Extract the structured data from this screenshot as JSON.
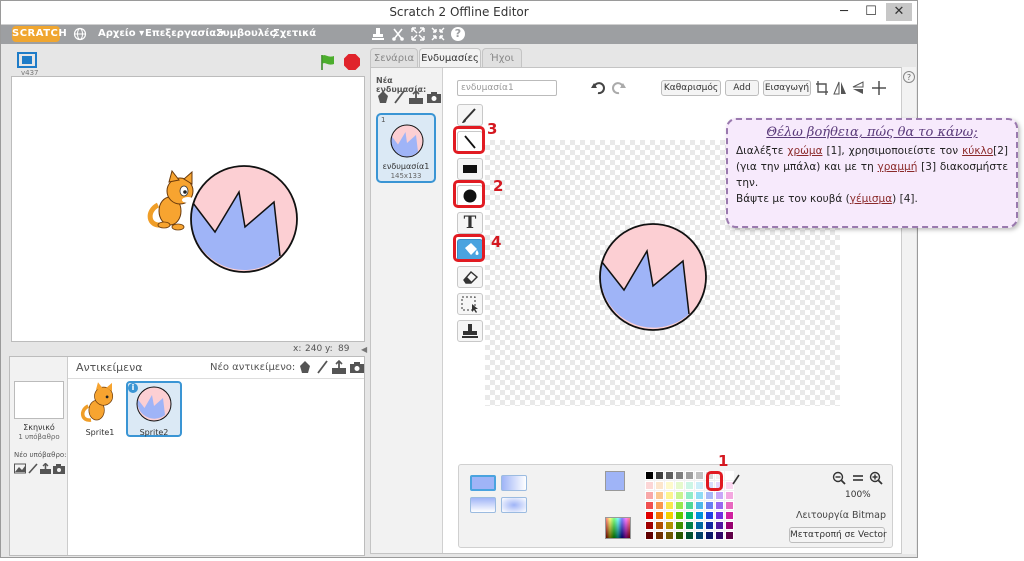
{
  "window": {
    "title": "Scratch 2 Offline Editor",
    "minimize": "─",
    "maximize": "☐",
    "close": "✕"
  },
  "menu": {
    "logo": "SCRATCH",
    "items": [
      "Αρχείο ▾",
      "Επεξεργασία ▾",
      "Συμβουλές",
      "Σχετικά"
    ]
  },
  "stage": {
    "version": "v437",
    "x_label": "x:",
    "x_value": "240",
    "y_label": "y:",
    "y_value": "89"
  },
  "sprites_pane": {
    "title": "Αντικείμενα",
    "new_sprite_label": "Νέο αντικείμενο:",
    "stage_name": "Σκηνικό",
    "stage_backdrops": "1 υπόβαθρο",
    "new_backdrop_label": "Νέο υπόβαθρο:",
    "sprites": [
      "Sprite1",
      "Sprite2"
    ],
    "info": "i"
  },
  "tabs": [
    "Σενάρια",
    "Ενδυμασίες",
    "Ήχοι"
  ],
  "costumes": {
    "new_label": "Νέα ενδυμασία:",
    "items": [
      {
        "index": "1",
        "name": "ενδυμασία1",
        "size": "145x133"
      }
    ]
  },
  "paint_editor": {
    "costume_name": "ενδυμασία1",
    "clear": "Καθαρισμός",
    "add": "Add",
    "import": "Εισαγωγή",
    "zoom": "100%",
    "mode": "Λειτουργία Bitmap",
    "convert": "Μετατροπή σε Vector",
    "text_tool": "T",
    "help_q": "?"
  },
  "annotations": {
    "n1": "1",
    "n2": "2",
    "n3": "3",
    "n4": "4"
  },
  "help": {
    "title": "Θέλω βοήθεια, πώς θα το κάνω;",
    "p1_a": "Διαλέξτε",
    "p1_color": "χρώμα",
    "p1_b": "[1], χρησιμοποιείστε τον",
    "p1_circle": "κύκλο",
    "p1_c": "[2](για την μπάλα) και με τη",
    "p1_line": "γραμμή",
    "p1_d": "[3] διακοσμήστε την.",
    "p2_a": "Βάψτε με τον κουβά (",
    "p2_fill": "γέμισμα",
    "p2_b": ") [4]."
  },
  "colors": {
    "ball_pink": "#fccfd3",
    "ball_blue": "#9fb4f7",
    "selected_color": "#9fb4f7",
    "accent": "#4aa3df",
    "annot": "#e11b22"
  }
}
